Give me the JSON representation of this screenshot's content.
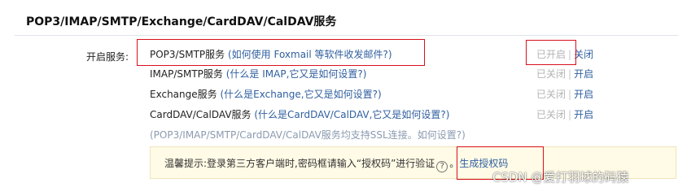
{
  "section": {
    "title": "POP3/IMAP/SMTP/Exchange/CardDAV/CalDAV服务"
  },
  "field_label": "开启服务:",
  "services": [
    {
      "name": "POP3/SMTP服务",
      "help": "(如何使用 Foxmail 等软件收发邮件?)",
      "state": "已开启",
      "sep": "|",
      "toggle": "关闭"
    },
    {
      "name": "IMAP/SMTP服务",
      "help": "(什么是 IMAP,它又是如何设置?)",
      "state": "已关闭",
      "sep": "|",
      "toggle": "开启"
    },
    {
      "name": "Exchange服务",
      "help": "(什么是Exchange,它又是如何设置?)",
      "state": "已关闭",
      "sep": "|",
      "toggle": "开启"
    },
    {
      "name": "CardDAV/CalDAV服务",
      "help": "(什么是CardDAV/CalDAV,它又是如何设置?)",
      "state": "已关闭",
      "sep": "|",
      "toggle": "开启"
    }
  ],
  "ssl_note": "(POP3/IMAP/SMTP/CardDAV/CalDAV服务均支持SSL连接。如何设置?)",
  "tip": {
    "text": "温馨提示:登录第三方客户端时,密码框请输入“授权码”进行验证",
    "help_icon": "?",
    "link": "生成授权码"
  },
  "watermark": "CSDN @爱打羽球的码猿",
  "colors": {
    "link": "#2f5f9f",
    "muted": "#b3b3b3",
    "highlight_border": "#d9101d",
    "tip_bg": "#fffbe6"
  }
}
